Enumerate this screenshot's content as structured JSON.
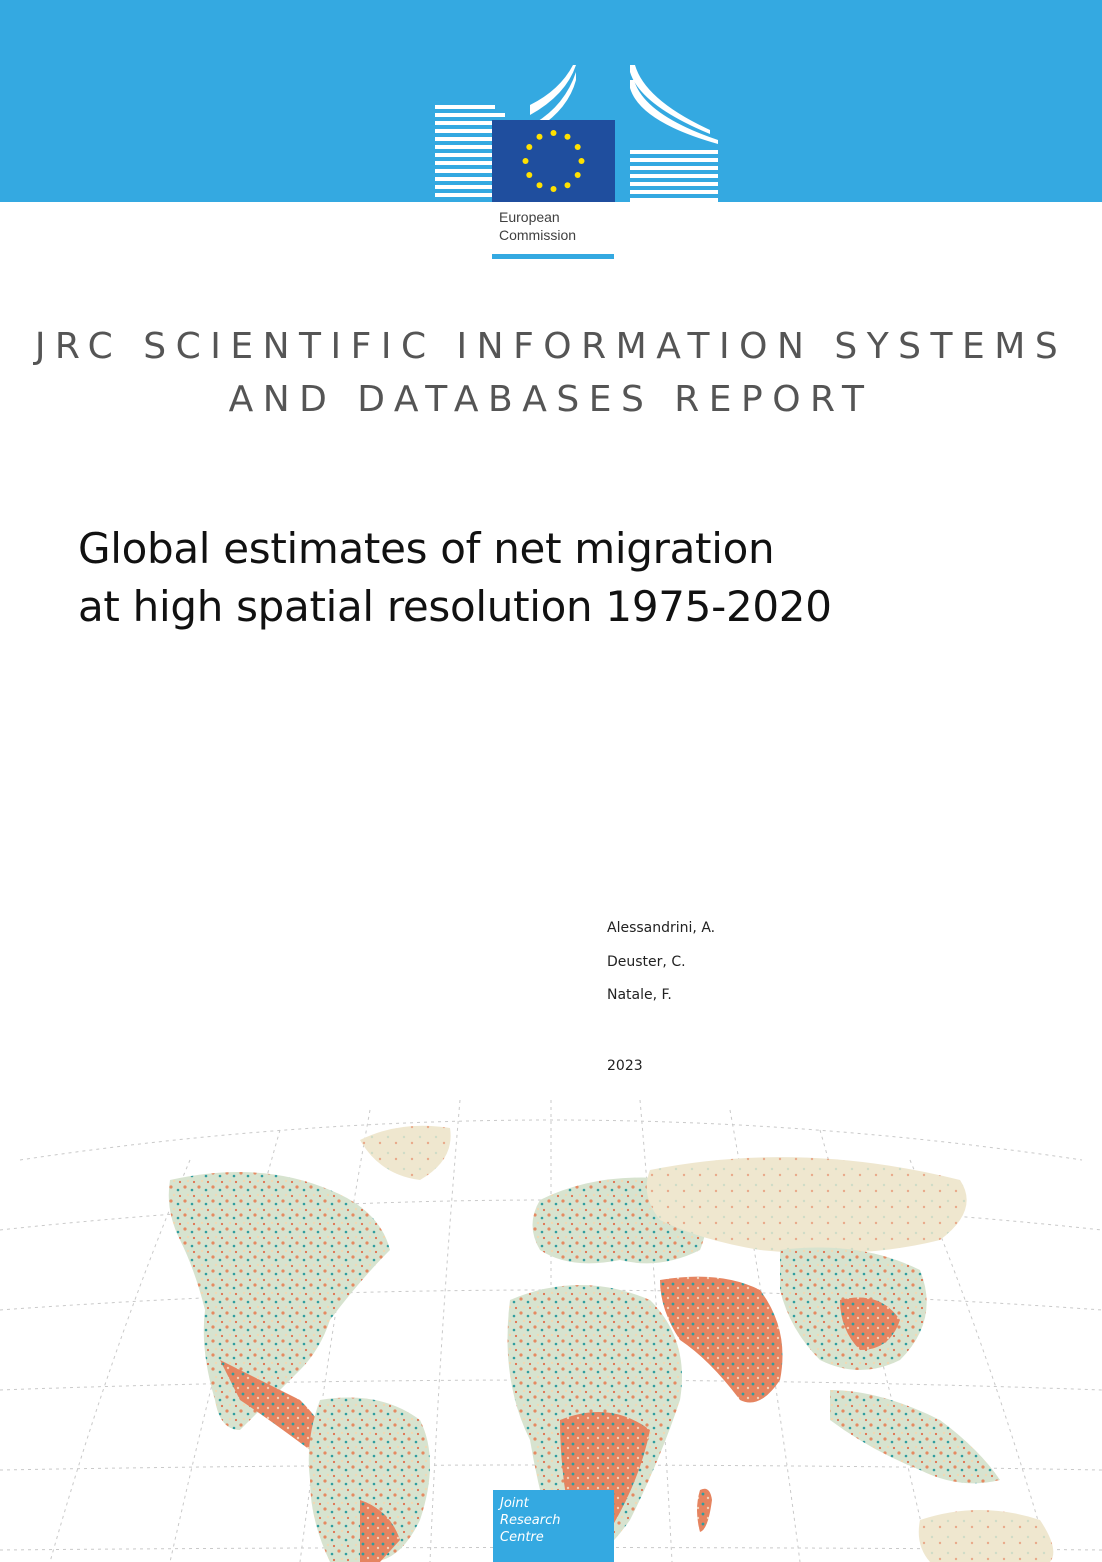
{
  "header": {
    "logo_text": [
      "European",
      "Commission"
    ],
    "colors": {
      "band": "#34a9e1",
      "flag": "#1f4e9e",
      "stars": "#ffe100"
    }
  },
  "series_title": [
    "JRC SCIENTIFIC INFORMATION SYSTEMS",
    "AND DATABASES REPORT"
  ],
  "title": [
    "Global estimates of net migration",
    "at high spatial resolution 1975-2020"
  ],
  "authors": [
    "Alessandrini, A.",
    "Deuster, C.",
    "Natale, F."
  ],
  "year": "2023",
  "footer": {
    "jrc_label": [
      "Joint",
      "Research",
      "Centre"
    ]
  },
  "map": {
    "description_icon": "world-map-icon",
    "palette": {
      "positive": "#2a9a9c",
      "negative": "#e07350",
      "neutral": "#d4e1cf",
      "light": "#f2e6c6"
    }
  }
}
